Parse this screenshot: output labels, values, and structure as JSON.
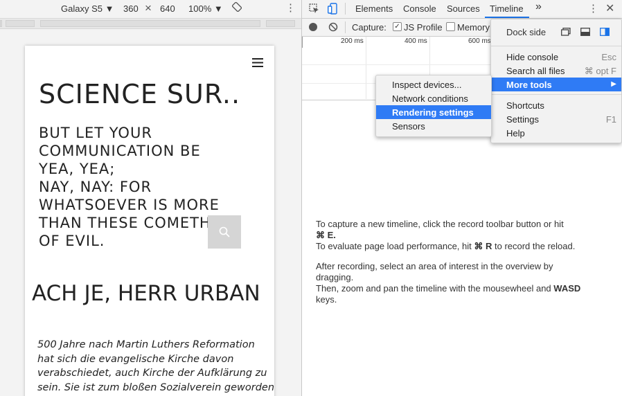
{
  "device_toolbar": {
    "device": "Galaxy S5",
    "width": "360",
    "times": "×",
    "height": "640",
    "zoom": "100%"
  },
  "website": {
    "title": "SCIENCE SUR..",
    "quote_lines": [
      "BUT LET YOUR",
      "COMMUNICATION BE",
      "YEA, YEA;",
      "NAY, NAY: FOR",
      "WHATSOEVER IS MORE",
      "THAN THESE COMETH",
      "OF EVIL."
    ],
    "post_title": "ACH JE, HERR URBAN",
    "post_body_lines": [
      "500 Jahre nach Martin Luthers Reformation",
      "hat sich die evangelische Kirche davon",
      "verabschiedet, auch Kirche der Aufklärung zu",
      "sein. Sie ist zum bloßen Sozialverein geworden,"
    ]
  },
  "devtools": {
    "tabs": [
      "Elements",
      "Console",
      "Sources",
      "Timeline"
    ],
    "active_tab": "Timeline",
    "more_tabs": "»",
    "capture_label": "Capture:",
    "js_profile_label": "JS Profile",
    "js_profile_checked": true,
    "memory_label": "Memory",
    "memory_checked": false,
    "ruler": [
      "200 ms",
      "400 ms",
      "600 ms"
    ],
    "help": {
      "line1": "To capture a new timeline, click the record toolbar button or hit",
      "line1_key": "⌘ E.",
      "line2_pre": "To evaluate page load performance, hit ",
      "line2_key": "⌘ R",
      "line2_post": " to record the reload.",
      "line3": "After recording, select an area of interest in the overview by",
      "line3b": "dragging.",
      "line4_pre": "Then, zoom and pan the timeline with the mousewheel and ",
      "line4_key": "WASD",
      "line4b": "keys."
    }
  },
  "main_menu": {
    "dock_side": "Dock side",
    "items": [
      {
        "label": "Hide console",
        "shortcut": "Esc"
      },
      {
        "label": "Search all files",
        "shortcut": "⌘ opt F"
      },
      {
        "label": "More tools",
        "shortcut": "▶",
        "selected": true
      },
      {
        "label": "Shortcuts",
        "shortcut": ""
      },
      {
        "label": "Settings",
        "shortcut": "F1"
      },
      {
        "label": "Help",
        "shortcut": ""
      }
    ]
  },
  "more_tools_menu": {
    "items": [
      {
        "label": "Inspect devices..."
      },
      {
        "label": "Network conditions"
      },
      {
        "label": "Rendering settings",
        "selected": true
      },
      {
        "label": "Sensors"
      }
    ]
  },
  "colors": {
    "selection": "#2f7bf5",
    "accent_blue": "#1a73e8"
  }
}
